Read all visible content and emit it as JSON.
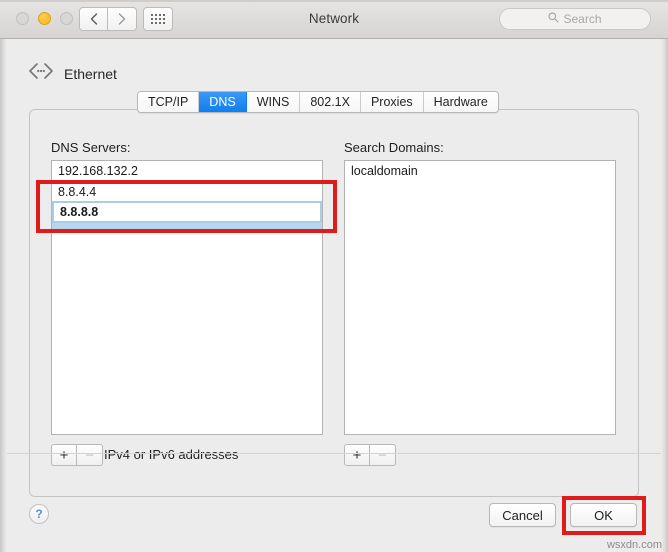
{
  "window": {
    "title": "Network",
    "traffic_lights": {
      "close": "close-button",
      "minimize": "minimize-button",
      "zoom": "zoom-button"
    },
    "nav": {
      "back": "back-chevron-icon",
      "forward": "forward-chevron-icon",
      "show_all": "grid-icon"
    },
    "search": {
      "placeholder": "Search",
      "value": "",
      "icon": "search-icon"
    }
  },
  "service": {
    "icon": "ethernet-icon",
    "name": "Ethernet"
  },
  "tabs": [
    {
      "label": "TCP/IP",
      "selected": false
    },
    {
      "label": "DNS",
      "selected": true
    },
    {
      "label": "WINS",
      "selected": false
    },
    {
      "label": "802.1X",
      "selected": false
    },
    {
      "label": "Proxies",
      "selected": false
    },
    {
      "label": "Hardware",
      "selected": false
    }
  ],
  "dns_servers": {
    "label": "DNS Servers:",
    "items": [
      {
        "value": "192.168.132.2",
        "state": "normal"
      },
      {
        "value": "8.8.4.4",
        "state": "normal"
      },
      {
        "value": "8.8.8.8",
        "state": "editing"
      }
    ],
    "add_label": "+",
    "remove_label": "−",
    "remove_disabled": true,
    "hint": "IPv4 or IPv6 addresses"
  },
  "search_domains": {
    "label": "Search Domains:",
    "items": [
      {
        "value": "localdomain",
        "state": "normal"
      }
    ],
    "add_label": "+",
    "remove_label": "−",
    "remove_disabled": true
  },
  "footer": {
    "help_label": "?",
    "cancel_label": "Cancel",
    "ok_label": "OK"
  },
  "annotations": {
    "color": "#e01b1b",
    "highlight_dns_rows": "8.8.4.4 / 8.8.8.8",
    "highlight_ok": "OK"
  },
  "watermark": "wsxdn.com"
}
